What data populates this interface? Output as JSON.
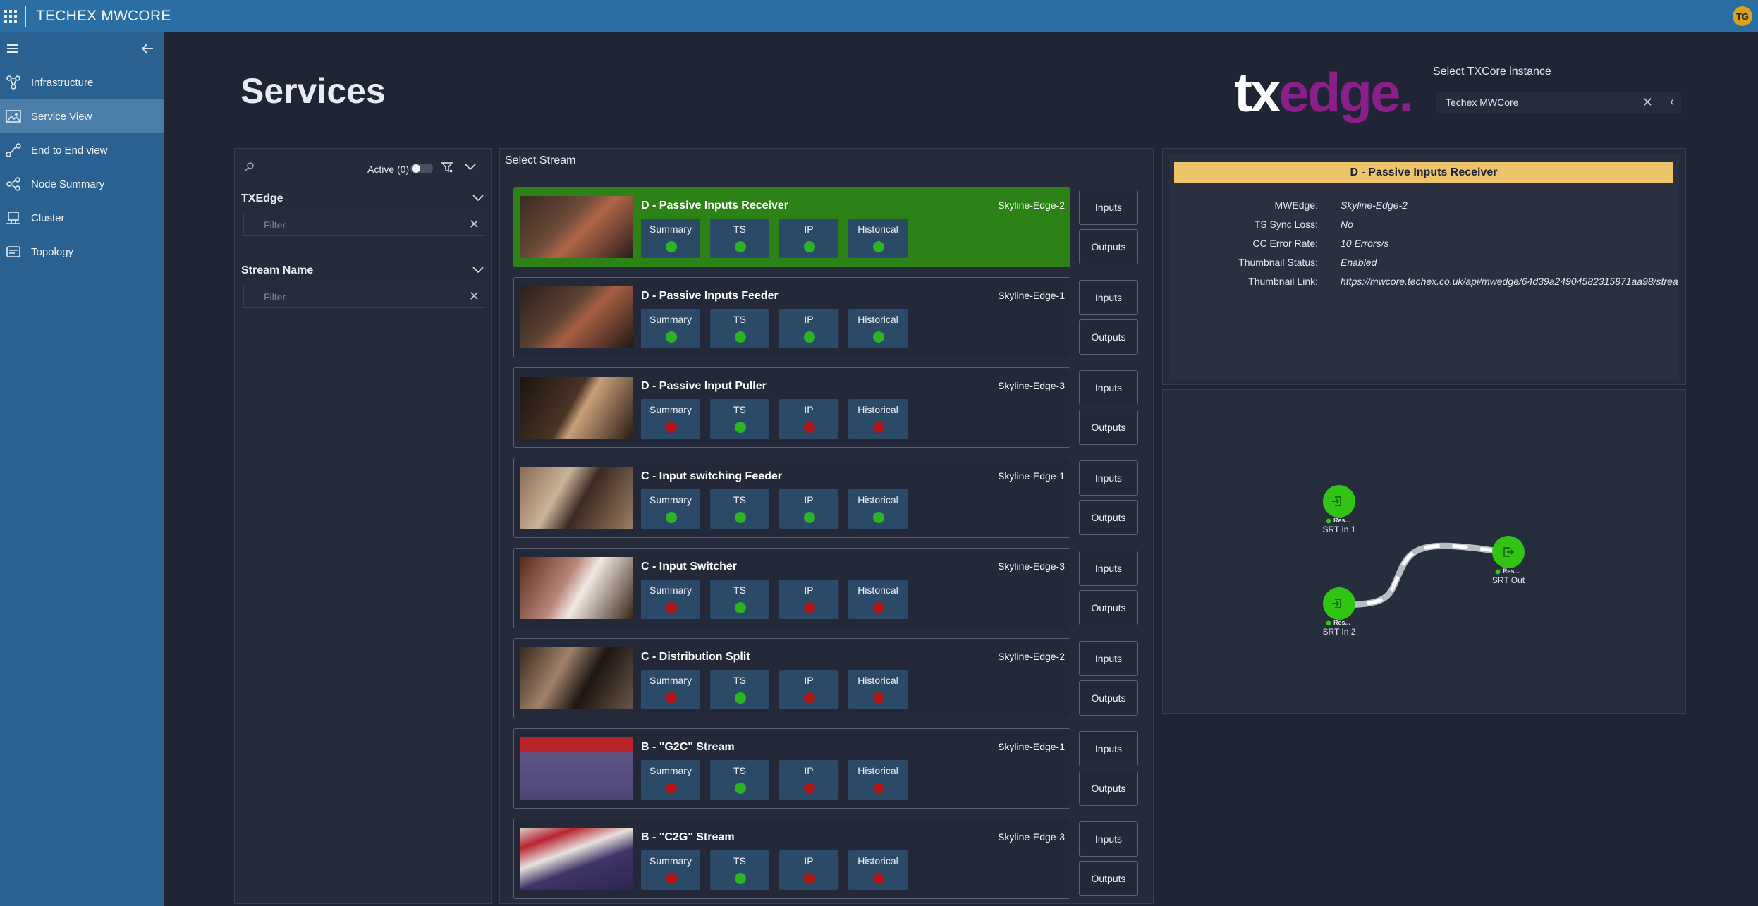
{
  "app": {
    "title": "TECHEX MWCORE",
    "user_initials": "TG"
  },
  "sidebar": {
    "items": [
      {
        "label": "Infrastructure",
        "icon": "infrastructure-icon",
        "active": false
      },
      {
        "label": "Service View",
        "icon": "service-view-icon",
        "active": true
      },
      {
        "label": "End to End view",
        "icon": "end-to-end-icon",
        "active": false
      },
      {
        "label": "Node Summary",
        "icon": "node-summary-icon",
        "active": false
      },
      {
        "label": "Cluster",
        "icon": "cluster-icon",
        "active": false
      },
      {
        "label": "Topology",
        "icon": "topology-icon",
        "active": false
      }
    ]
  },
  "header": {
    "page_title": "Services",
    "logo_tx": "tx",
    "logo_edge": "edge.",
    "instance_label": "Select TXCore instance",
    "instance_value": "Techex MWCore"
  },
  "filters": {
    "active_label": "Active (0)",
    "groups": [
      {
        "title": "TXEdge",
        "placeholder": "Filter"
      },
      {
        "title": "Stream Name",
        "placeholder": "Filter"
      }
    ]
  },
  "streams": {
    "heading": "Select Stream",
    "metric_labels": [
      "Summary",
      "TS",
      "IP",
      "Historical"
    ],
    "inputs_label": "Inputs",
    "outputs_label": "Outputs",
    "items": [
      {
        "name": "D - Passive Inputs Receiver",
        "node": "Skyline-Edge-2",
        "status": [
          "green",
          "green",
          "green",
          "green"
        ],
        "selected": true
      },
      {
        "name": "D - Passive Inputs Feeder",
        "node": "Skyline-Edge-1",
        "status": [
          "green",
          "green",
          "green",
          "green"
        ],
        "selected": false
      },
      {
        "name": "D - Passive Input Puller",
        "node": "Skyline-Edge-3",
        "status": [
          "red",
          "green",
          "red",
          "red"
        ],
        "selected": false
      },
      {
        "name": "C - Input switching Feeder",
        "node": "Skyline-Edge-1",
        "status": [
          "green",
          "green",
          "green",
          "green"
        ],
        "selected": false
      },
      {
        "name": "C - Input Switcher",
        "node": "Skyline-Edge-3",
        "status": [
          "red",
          "green",
          "red",
          "red"
        ],
        "selected": false
      },
      {
        "name": "C - Distribution Split",
        "node": "Skyline-Edge-2",
        "status": [
          "red",
          "green",
          "red",
          "red"
        ],
        "selected": false
      },
      {
        "name": "B - \"G2C\" Stream",
        "node": "Skyline-Edge-1",
        "status": [
          "red",
          "green",
          "red",
          "red"
        ],
        "selected": false
      },
      {
        "name": "B - \"C2G\" Stream",
        "node": "Skyline-Edge-3",
        "status": [
          "red",
          "green",
          "red",
          "red"
        ],
        "selected": false
      }
    ]
  },
  "details": {
    "title": "D - Passive Inputs Receiver",
    "rows": [
      {
        "key": "MWEdge:",
        "value": "Skyline-Edge-2"
      },
      {
        "key": "TS Sync Loss:",
        "value": "No"
      },
      {
        "key": "CC Error Rate:",
        "value": "10 Errors/s"
      },
      {
        "key": "Thumbnail Status:",
        "value": "Enabled"
      },
      {
        "key": "Thumbnail Link:",
        "value": "https://mwcore.techex.co.uk/api/mwedge/64d39a24904582315871aa98/strea"
      }
    ]
  },
  "graph": {
    "nodes": [
      {
        "label": "SRT In 1",
        "sub": "Res..."
      },
      {
        "label": "SRT In 2",
        "sub": "Res..."
      },
      {
        "label": "SRT Out",
        "sub": "Res..."
      }
    ]
  },
  "colors": {
    "topbar": "#2a6ea4",
    "sidebar": "#2a6191",
    "selected_card": "#2d8217",
    "status_ok": "#2bb522",
    "status_error": "#b01818",
    "details_title": "#eec46a",
    "logo_accent": "#8a1f8a"
  }
}
